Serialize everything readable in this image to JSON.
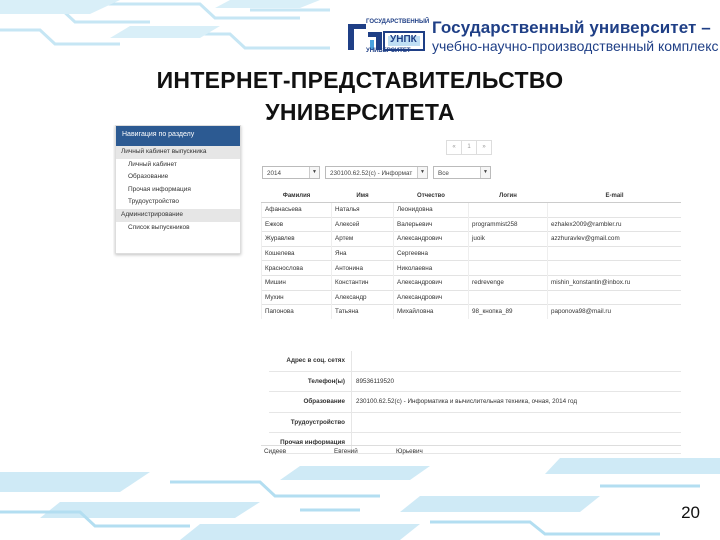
{
  "colors": {
    "brand": "#1f3f86",
    "nav_header": "#2c5a92",
    "decor": "#bfe3f3"
  },
  "logo": {
    "mark_lines": [
      "ГОСУДАРСТВЕННЫЙ",
      "УНПК",
      "УНИВЕРСИТЕТ"
    ],
    "title": "Государственный университет –",
    "subtitle": "учебно-научно-производственный комплекс"
  },
  "slide": {
    "title_line1": "ИНТЕРНЕТ-ПРЕДСТАВИТЕЛЬСТВО",
    "title_line2": "УНИВЕРСИТЕТА",
    "page_number": "20"
  },
  "sidebar": {
    "header": "Навигация по разделу",
    "items": [
      "Личный кабинет выпускника",
      "Личный кабинет",
      "Образование",
      "Прочая информация",
      "Трудоустройство",
      "Администрирование",
      "Список выпускников"
    ]
  },
  "pager": [
    "«",
    "1",
    "»"
  ],
  "filters": {
    "year": "2014",
    "speciality": "230100.62.52(с) - Информат",
    "status": "Все"
  },
  "table": {
    "columns": [
      "Фамилия",
      "Имя",
      "Отчество",
      "Логин",
      "E-mail"
    ],
    "rows": [
      [
        "Афанасьева",
        "Наталья",
        "Леонидовна",
        "",
        ""
      ],
      [
        "Ежков",
        "Алексей",
        "Валерьевич",
        "programmist258",
        "ezhalex2009@rambler.ru"
      ],
      [
        "Журавлев",
        "Артем",
        "Александрович",
        "juoik",
        "azzhuravlev@gmail.com"
      ],
      [
        "Кошелева",
        "Яна",
        "Сергеевна",
        "",
        ""
      ],
      [
        "Краснослова",
        "Антонина",
        "Николаевна",
        "",
        ""
      ],
      [
        "Мишин",
        "Константин",
        "Александрович",
        "redrevenge",
        "mishin_konstantin@inbox.ru"
      ],
      [
        "Мухин",
        "Александр",
        "Александрович",
        "",
        ""
      ],
      [
        "Папонова",
        "Татьяна",
        "Михайловна",
        "98_кнопка_89",
        "paponova98@mail.ru"
      ]
    ]
  },
  "details": [
    {
      "label": "Адрес в соц. сетях",
      "value": ""
    },
    {
      "label": "Телефон(ы)",
      "value": "89536119520"
    },
    {
      "label": "Образование",
      "value": "230100.62.52(с) - Информатика и вычислительная техника, очная, 2014 год"
    },
    {
      "label": "Трудоустройство",
      "value": ""
    },
    {
      "label": "Прочая информация",
      "value": ""
    }
  ],
  "last_row": [
    "Сидеев",
    "Евгений",
    "Юрьевич"
  ]
}
